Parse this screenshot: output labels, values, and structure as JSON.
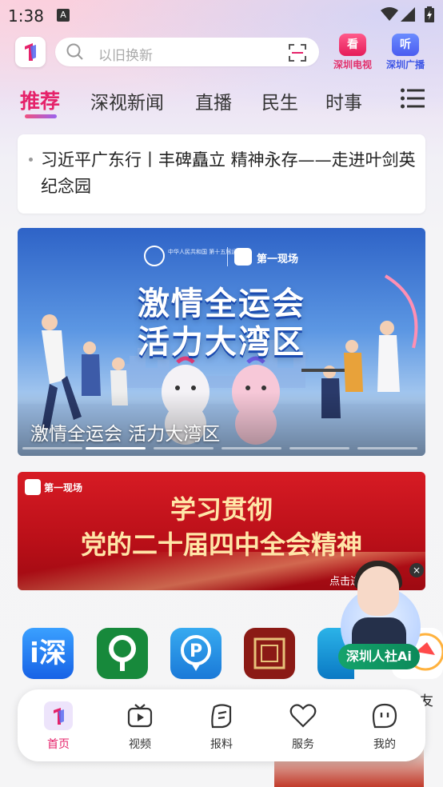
{
  "status_bar": {
    "time": "1:38",
    "notification_icon": "A"
  },
  "header": {
    "search_placeholder": "以旧换新",
    "tv": {
      "badge": "看",
      "label": "深圳电视"
    },
    "radio": {
      "badge": "听",
      "label": "深圳广播"
    }
  },
  "tabs": [
    "推荐",
    "深视新闻",
    "直播",
    "民生",
    "时事"
  ],
  "headline": "习近平广东行丨丰碑矗立 精神永存——走进叶剑英纪念园",
  "banner": {
    "title_line1": "激情全运会",
    "title_line2": "活力大湾区",
    "caption": "激情全运会 活力大湾区",
    "brand": "第一现场",
    "org_text": "中华人民共和国 第十五届运动会",
    "slides": 6,
    "active_slide": 2
  },
  "red_banner": {
    "brand": "第一现场",
    "line1": "学习贯彻",
    "line2": "党的二十届四中全会精神",
    "enter": "点击进入"
  },
  "apps": [
    {
      "icon": "shenzhen-social-security-icon",
      "glyph": "i深"
    },
    {
      "icon": "tree-icon"
    },
    {
      "icon": "parking-icon"
    },
    {
      "icon": "seal-icon"
    },
    {
      "icon": "library-icon"
    },
    {
      "icon": "partial-app-icon"
    }
  ],
  "side_text": "交友",
  "ai_assistant": {
    "label": "深圳人社Ai",
    "close": "×"
  },
  "bottom_nav": [
    {
      "label": "首页",
      "icon": "home-logo-icon",
      "active": true
    },
    {
      "label": "视频",
      "icon": "video-icon"
    },
    {
      "label": "报料",
      "icon": "report-icon"
    },
    {
      "label": "服务",
      "icon": "heart-icon"
    },
    {
      "label": "我的",
      "icon": "profile-icon"
    }
  ],
  "colors": {
    "accent": "#e5226a",
    "radio_blue": "#3d55e6",
    "ai_green": "#14a36b"
  }
}
